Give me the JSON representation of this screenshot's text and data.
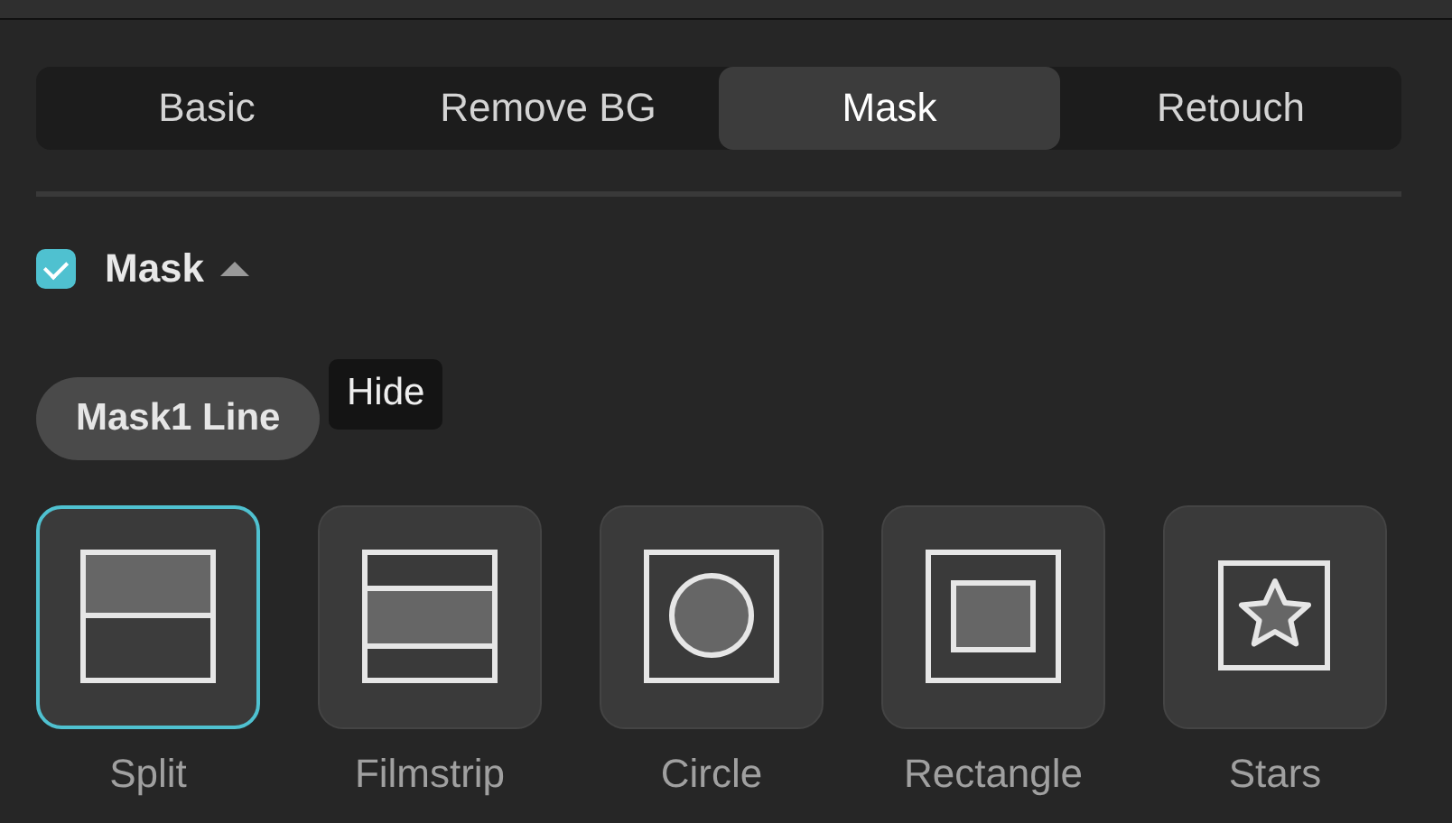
{
  "tabs": [
    {
      "label": "Basic",
      "selected": false
    },
    {
      "label": "Remove BG",
      "selected": false
    },
    {
      "label": "Mask",
      "selected": true
    },
    {
      "label": "Retouch",
      "selected": false
    }
  ],
  "section": {
    "title": "Mask",
    "checked": true,
    "expanded": true
  },
  "mask_chip": {
    "label": "Mask1 Line"
  },
  "tooltip": {
    "text": "Hide"
  },
  "styles": [
    {
      "kind": "split",
      "label": "Split",
      "selected": true
    },
    {
      "kind": "filmstrip",
      "label": "Filmstrip",
      "selected": false
    },
    {
      "kind": "circle",
      "label": "Circle",
      "selected": false
    },
    {
      "kind": "rectangle",
      "label": "Rectangle",
      "selected": false
    },
    {
      "kind": "stars",
      "label": "Stars",
      "selected": false
    }
  ]
}
